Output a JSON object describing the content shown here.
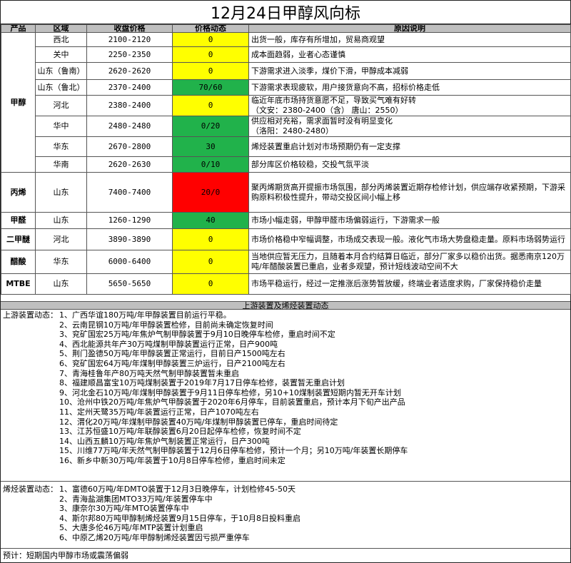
{
  "title": "12月24日甲醇风向标",
  "headers": [
    "产品",
    "区域",
    "收盘价格",
    "价格动态",
    "原因说明"
  ],
  "groups": [
    {
      "product": "甲醇",
      "rows": [
        {
          "region": "西北",
          "price": "2100-2120",
          "move": "0",
          "tone": "yellow",
          "reason": "出货一般，库存有所增加，贸易商观望"
        },
        {
          "region": "关中",
          "price": "2250-2350",
          "move": "0",
          "tone": "yellow",
          "reason": "成本面趋弱，业者心态谨慎"
        },
        {
          "region": "山东（鲁南）",
          "price": "2620-2620",
          "move": "0",
          "tone": "yellow",
          "reason": "下游需求进入淡季，煤价下滑，甲醇成本减弱"
        },
        {
          "region": "山东（鲁北）",
          "price": "2370-2400",
          "move": "70/60",
          "tone": "green",
          "reason": "下游需求表现疲软，用户接货意向不高，招标价格走低"
        },
        {
          "region": "河北",
          "price": "2380-2400",
          "move": "0",
          "tone": "yellow",
          "reason": "临近年底市场持货意愿不足，导致买气难有好转",
          "reason2": "（文安：2380-2400（含） 唐山：2550）"
        },
        {
          "region": "华中",
          "price": "2480-2480",
          "move": "0/20",
          "tone": "green",
          "reason": "供应相对充裕，需求面暂时没有明显变化",
          "reason2": "（洛阳：2480-2480）"
        },
        {
          "region": "华东",
          "price": "2670-2800",
          "move": "30",
          "tone": "green",
          "reason": "烯烃装置重启计划对市场预期仍有一定支撑"
        },
        {
          "region": "华南",
          "price": "2620-2630",
          "move": "0/10",
          "tone": "green",
          "reason": "部分库区价格较稳，交投气氛平淡"
        }
      ]
    },
    {
      "product": "丙烯",
      "rows": [
        {
          "region": "山东",
          "price": "7400-7400",
          "move": "20/0",
          "tone": "red",
          "reason": "聚丙烯期货高开提振市场氛围，部分丙烯装置近期存检修计划，供应端存收紧预期，下游采购原料积极性提升，带动交投区间小幅上移"
        }
      ]
    },
    {
      "product": "甲醛",
      "rows": [
        {
          "region": "山东",
          "price": "1260-1290",
          "move": "40",
          "tone": "green",
          "reason": "市场小幅走弱，甲醇甲醛市场偏弱运行，下游需求一般"
        }
      ]
    },
    {
      "product": "二甲醚",
      "rows": [
        {
          "region": "河北",
          "price": "3890-3890",
          "move": "0",
          "tone": "yellow",
          "reason": "市场价格稳中窄幅调整，市场成交表现一般。液化气市场大势盘稳走量。原料市场弱势运行"
        }
      ]
    },
    {
      "product": "醋酸",
      "rows": [
        {
          "region": "华东",
          "price": "6000-6400",
          "move": "0",
          "tone": "yellow",
          "reason": "当地供应暂无压力，且随着本月合约结算日临近，部分厂家多以稳价出货。据悉南京120万吨/年醋酸装置已重启，业者多观望，预计短线波动空间不大"
        }
      ]
    },
    {
      "product": "MTBE",
      "rows": [
        {
          "region": "山东",
          "price": "5650-5650",
          "move": "0",
          "tone": "yellow",
          "reason": "市场平稳运行，经过一定推涨后涨势暂放缓，终端业者适度求购，厂家保持稳价走量"
        }
      ]
    }
  ],
  "upstream": {
    "section_title": "上游装置及烯烃装置动态",
    "lead": "上游装置动态：",
    "items": [
      "1、广西华谊180万吨/年甲醇装置目前运行平稳。",
      "2、云南昆钢10万吨/年甲醇装置检修，目前尚未确定恢复时间",
      "3、兖矿国宏25万吨/年焦炉气制甲醇装置于9月10日晚停车检修，重启时间不定",
      "4、西北能源共年产30万吨煤制甲醇装置运行正常，日产900吨",
      "5、荆门盈德50万吨/年甲醇装置正常运行，目前日产1500吨左右",
      "6、兖矿国宏64万吨/年煤制甲醇装置三炉运行，日产2100吨左右",
      "7、青海桂鲁年产80万吨天然气制甲醇装置暂未重启",
      "8、福建顺昌富宝10万吨煤制装置于2019年7月17日停车检修，装置暂无重启计划",
      "9、河北金石10万吨/年煤制甲醇装置于9月11日停车检修，另10+10煤制装置短期内暂无开车计划",
      "10、沧州中铁20万吨/年焦炉气甲醇装置于2020年6月停车，目前装置重启，预计本月下旬产出产品",
      "11、定州天鹭35万吨/年装置运行正常，日产1070吨左右",
      "12、渭化20万吨/年煤制甲醇装置40万吨/年煤制甲醇装置已停车，重启时间待定",
      "13、江苏恒盛10万吨/年联醇装置6月20日起停车检修，恢复时间不定",
      "14、山西五麟10万吨/年焦炉气制装置正常运行，日产300吨",
      "15、川维77万吨/年天然气制甲醇装置于12月6日停车检修，预计一个月；另10万吨/年装置长期停车",
      "16、新乡中新30万吨/年装置于10月8日停车检修，重启时间未定"
    ]
  },
  "olefin": {
    "lead": "烯烃装置动态：",
    "items": [
      "1、富德60万吨/年DMTO装置于12月3日晚停车，计划检修45-50天",
      "2、青海盐湖集团MTO33万吨/年装置停车中",
      "3、康奈尔30万吨/年MTO装置停车中",
      "4、斯尔邦80万吨甲醇制烯烃装置9月15日停车，于10月8日投料重启",
      "5、大唐多伦46万吨/年MTP装置计划重启",
      "6、中原乙烯20万吨/年甲醇制烯烃装置因亏损严重停车"
    ]
  },
  "forecast": "预计：短期国内甲醇市场或震荡偏弱"
}
